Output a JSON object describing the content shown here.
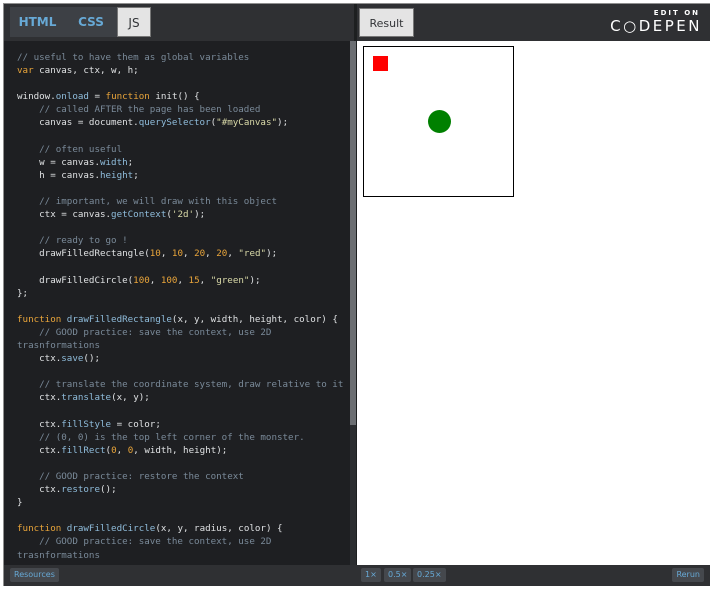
{
  "editor": {
    "tabs": [
      {
        "label": "HTML"
      },
      {
        "label": "CSS"
      },
      {
        "label": "JS"
      }
    ],
    "code_lines": [
      [
        {
          "t": "// useful to have them as global variables",
          "c": "#7a8a99"
        }
      ],
      [
        {
          "t": "var ",
          "c": "#e8a43a"
        },
        {
          "t": "canvas, ctx, w, h;",
          "c": "#dfe1e3"
        }
      ],
      [],
      [
        {
          "t": "window.",
          "c": "#dfe1e3"
        },
        {
          "t": "onload",
          "c": "#8fbcdb"
        },
        {
          "t": " = ",
          "c": "#dfe1e3"
        },
        {
          "t": "function ",
          "c": "#e8a43a"
        },
        {
          "t": "init() {",
          "c": "#dfe1e3"
        }
      ],
      [
        {
          "t": "    // called AFTER the page has been loaded",
          "c": "#7a8a99"
        }
      ],
      [
        {
          "t": "    canvas = document.",
          "c": "#dfe1e3"
        },
        {
          "t": "querySelector",
          "c": "#8fbcdb"
        },
        {
          "t": "(",
          "c": "#dfe1e3"
        },
        {
          "t": "\"#myCanvas\"",
          "c": "#d9d9a8"
        },
        {
          "t": ");",
          "c": "#dfe1e3"
        }
      ],
      [],
      [
        {
          "t": "    // often useful",
          "c": "#7a8a99"
        }
      ],
      [
        {
          "t": "    w = canvas.",
          "c": "#dfe1e3"
        },
        {
          "t": "width",
          "c": "#8fbcdb"
        },
        {
          "t": ";",
          "c": "#dfe1e3"
        }
      ],
      [
        {
          "t": "    h = canvas.",
          "c": "#dfe1e3"
        },
        {
          "t": "height",
          "c": "#8fbcdb"
        },
        {
          "t": ";",
          "c": "#dfe1e3"
        }
      ],
      [],
      [
        {
          "t": "    // important, we will draw with this object",
          "c": "#7a8a99"
        }
      ],
      [
        {
          "t": "    ctx = canvas.",
          "c": "#dfe1e3"
        },
        {
          "t": "getContext",
          "c": "#8fbcdb"
        },
        {
          "t": "(",
          "c": "#dfe1e3"
        },
        {
          "t": "'2d'",
          "c": "#d9d9a8"
        },
        {
          "t": ");",
          "c": "#dfe1e3"
        }
      ],
      [],
      [
        {
          "t": "    // ready to go !",
          "c": "#7a8a99"
        }
      ],
      [
        {
          "t": "    drawFilledRectangle(",
          "c": "#dfe1e3"
        },
        {
          "t": "10",
          "c": "#e8a43a"
        },
        {
          "t": ", ",
          "c": "#dfe1e3"
        },
        {
          "t": "10",
          "c": "#e8a43a"
        },
        {
          "t": ", ",
          "c": "#dfe1e3"
        },
        {
          "t": "20",
          "c": "#e8a43a"
        },
        {
          "t": ", ",
          "c": "#dfe1e3"
        },
        {
          "t": "20",
          "c": "#e8a43a"
        },
        {
          "t": ", ",
          "c": "#dfe1e3"
        },
        {
          "t": "\"red\"",
          "c": "#d9d9a8"
        },
        {
          "t": ");",
          "c": "#dfe1e3"
        }
      ],
      [],
      [
        {
          "t": "    drawFilledCircle(",
          "c": "#dfe1e3"
        },
        {
          "t": "100",
          "c": "#e8a43a"
        },
        {
          "t": ", ",
          "c": "#dfe1e3"
        },
        {
          "t": "100",
          "c": "#e8a43a"
        },
        {
          "t": ", ",
          "c": "#dfe1e3"
        },
        {
          "t": "15",
          "c": "#e8a43a"
        },
        {
          "t": ", ",
          "c": "#dfe1e3"
        },
        {
          "t": "\"green\"",
          "c": "#d9d9a8"
        },
        {
          "t": ");",
          "c": "#dfe1e3"
        }
      ],
      [
        {
          "t": "};",
          "c": "#dfe1e3"
        }
      ],
      [],
      [
        {
          "t": "function ",
          "c": "#e8a43a"
        },
        {
          "t": "drawFilledRectangle",
          "c": "#8fbcdb"
        },
        {
          "t": "(x, y, width, height, color) {",
          "c": "#dfe1e3"
        }
      ],
      [
        {
          "t": "    // GOOD practice: save the context, use 2D",
          "c": "#7a8a99"
        }
      ],
      [
        {
          "t": "trasnformations",
          "c": "#7a8a99"
        }
      ],
      [
        {
          "t": "    ctx.",
          "c": "#dfe1e3"
        },
        {
          "t": "save",
          "c": "#8fbcdb"
        },
        {
          "t": "();",
          "c": "#dfe1e3"
        }
      ],
      [],
      [
        {
          "t": "    // translate the coordinate system, draw relative to it",
          "c": "#7a8a99"
        }
      ],
      [
        {
          "t": "    ctx.",
          "c": "#dfe1e3"
        },
        {
          "t": "translate",
          "c": "#8fbcdb"
        },
        {
          "t": "(x, y);",
          "c": "#dfe1e3"
        }
      ],
      [],
      [
        {
          "t": "    ctx.",
          "c": "#dfe1e3"
        },
        {
          "t": "fillStyle",
          "c": "#8fbcdb"
        },
        {
          "t": " = color;",
          "c": "#dfe1e3"
        }
      ],
      [
        {
          "t": "    // (0, 0) is the top left corner of the monster.",
          "c": "#7a8a99"
        }
      ],
      [
        {
          "t": "    ctx.",
          "c": "#dfe1e3"
        },
        {
          "t": "fillRect",
          "c": "#8fbcdb"
        },
        {
          "t": "(",
          "c": "#dfe1e3"
        },
        {
          "t": "0",
          "c": "#e8a43a"
        },
        {
          "t": ", ",
          "c": "#dfe1e3"
        },
        {
          "t": "0",
          "c": "#e8a43a"
        },
        {
          "t": ", width, height);",
          "c": "#dfe1e3"
        }
      ],
      [],
      [
        {
          "t": "    // GOOD practice: restore the context",
          "c": "#7a8a99"
        }
      ],
      [
        {
          "t": "    ctx.",
          "c": "#dfe1e3"
        },
        {
          "t": "restore",
          "c": "#8fbcdb"
        },
        {
          "t": "();",
          "c": "#dfe1e3"
        }
      ],
      [
        {
          "t": "}",
          "c": "#dfe1e3"
        }
      ],
      [],
      [
        {
          "t": "function ",
          "c": "#e8a43a"
        },
        {
          "t": "drawFilledCircle",
          "c": "#8fbcdb"
        },
        {
          "t": "(x, y, radius, color) {",
          "c": "#dfe1e3"
        }
      ],
      [
        {
          "t": "    // GOOD practice: save the context, use 2D",
          "c": "#7a8a99"
        }
      ],
      [
        {
          "t": "trasnformations",
          "c": "#7a8a99"
        }
      ]
    ]
  },
  "result": {
    "tab_label": "Result",
    "edit_on": "EDIT ON",
    "brand": "C○DEPEN",
    "canvas": {
      "rect_color": "#ff0000",
      "circle_color": "#008000"
    }
  },
  "footer": {
    "resources": "Resources",
    "zoom": [
      "1×",
      "0.5×",
      "0.25×"
    ],
    "rerun": "Rerun"
  }
}
